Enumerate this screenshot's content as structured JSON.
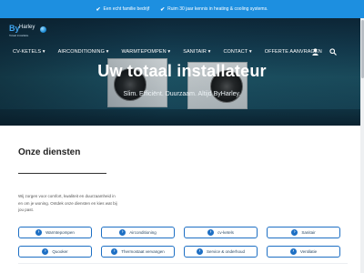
{
  "usp_bar": {
    "items": [
      "Een echt familie bedrijf",
      "Ruim 30 jaar kennis in heating & cooling systems."
    ]
  },
  "logo": {
    "by": "By",
    "name": "Harley",
    "tagline": "Totaal installatie"
  },
  "nav": {
    "items": [
      "CV-KETELS ▾",
      "AIRCONDITIONING ▾",
      "WARMTEPOMPEN ▾",
      "SANITAIR ▾",
      "CONTACT ▾",
      "OFFERTE AANVRAGEN"
    ],
    "icons": [
      "user-icon",
      "search-icon"
    ]
  },
  "hero": {
    "title": "Uw totaal installateur",
    "subtitle": "Slim. Efficiënt. Duurzaam. Altijd ByHarley."
  },
  "services": {
    "title": "Onze diensten",
    "intro": "Wij zorgen voor comfort, kwaliteit en duurzaamheid in en om je woning. Ontdek onze diensten en kies wat bij jou past.",
    "items": [
      {
        "label": "Warmtepompen"
      },
      {
        "label": "Airconditioning"
      },
      {
        "label": "cv-ketels"
      },
      {
        "label": "Sanitair"
      },
      {
        "label": "Quooker"
      },
      {
        "label": "Thermostaat vervangen"
      },
      {
        "label": "Service & onderhoud"
      },
      {
        "label": "Ventilatie"
      }
    ]
  },
  "colors": {
    "accent": "#1d8fe0",
    "button_border": "#1d6fc4",
    "hero_dark": "#0e2a3c"
  }
}
